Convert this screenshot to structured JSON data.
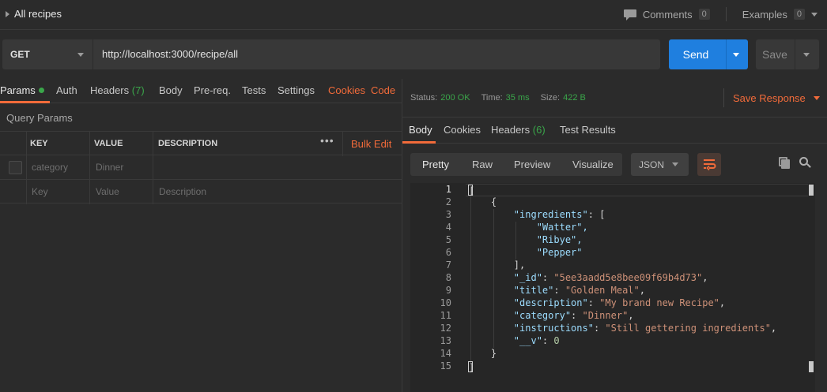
{
  "topbar": {
    "title": "All recipes",
    "comments_label": "Comments",
    "comments_count": "0",
    "examples_label": "Examples",
    "examples_count": "0"
  },
  "request": {
    "method": "GET",
    "url": "http://localhost:3000/recipe/all",
    "send_label": "Send",
    "save_label": "Save"
  },
  "req_tabs": {
    "params": "Params",
    "auth": "Auth",
    "headers": "Headers",
    "headers_count": "(7)",
    "body": "Body",
    "prereq": "Pre-req.",
    "tests": "Tests",
    "settings": "Settings",
    "cookies": "Cookies",
    "code": "Code"
  },
  "query_params": {
    "title": "Query Params",
    "columns": {
      "key": "KEY",
      "value": "VALUE",
      "description": "DESCRIPTION"
    },
    "bulk_edit": "Bulk Edit",
    "rows": [
      {
        "key": "category",
        "value": "Dinner",
        "description": ""
      }
    ],
    "placeholder": {
      "key": "Key",
      "value": "Value",
      "description": "Description"
    }
  },
  "response_status": {
    "status_label": "Status:",
    "status_value": "200 OK",
    "time_label": "Time:",
    "time_value": "35 ms",
    "size_label": "Size:",
    "size_value": "422 B",
    "save_response": "Save Response"
  },
  "res_tabs": {
    "body": "Body",
    "cookies": "Cookies",
    "headers": "Headers",
    "headers_count": "(6)",
    "test_results": "Test Results"
  },
  "view": {
    "pretty": "Pretty",
    "raw": "Raw",
    "preview": "Preview",
    "visualize": "Visualize",
    "format": "JSON"
  },
  "code": {
    "line_numbers": [
      "1",
      "2",
      "3",
      "4",
      "5",
      "6",
      "7",
      "8",
      "9",
      "10",
      "11",
      "12",
      "13",
      "14",
      "15"
    ],
    "ingredients": [
      "\"Watter\",",
      "\"Ribye\",",
      "\"Pepper\""
    ],
    "id": "\"5ee3aadd5e8bee09f69b4d73\"",
    "title": "\"Golden Meal\"",
    "description": "\"My brand new Recipe\"",
    "category": "\"Dinner\"",
    "instructions": "\"Still gettering ingredients\"",
    "v": "0"
  }
}
